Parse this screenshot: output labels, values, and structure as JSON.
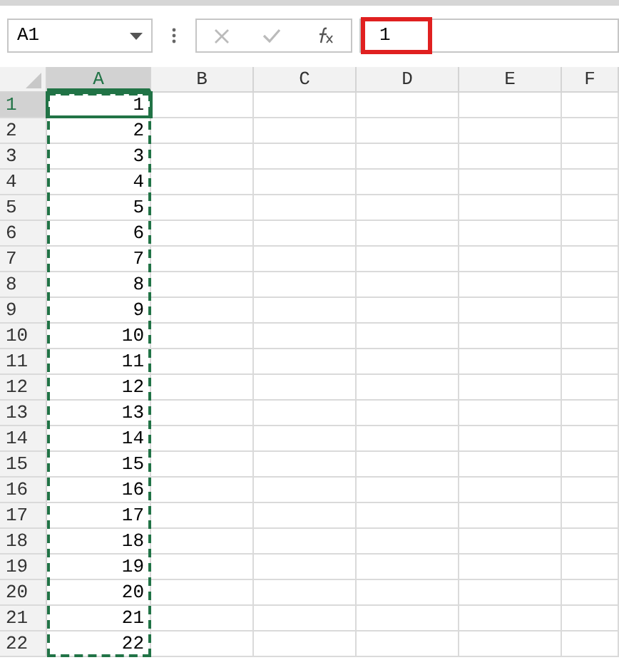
{
  "name_box": {
    "value": "A1"
  },
  "formula_bar": {
    "value": "1",
    "highlighted": true
  },
  "columns": [
    {
      "label": "A",
      "selected": true,
      "copied": true
    },
    {
      "label": "B",
      "selected": false,
      "copied": false
    },
    {
      "label": "C",
      "selected": false,
      "copied": false
    },
    {
      "label": "D",
      "selected": false,
      "copied": false
    },
    {
      "label": "E",
      "selected": false,
      "copied": false
    },
    {
      "label": "F",
      "selected": false,
      "copied": false
    }
  ],
  "rows": [
    {
      "label": "1",
      "selected": true,
      "cells": [
        "1"
      ]
    },
    {
      "label": "2",
      "selected": false,
      "cells": [
        "2"
      ]
    },
    {
      "label": "3",
      "selected": false,
      "cells": [
        "3"
      ]
    },
    {
      "label": "4",
      "selected": false,
      "cells": [
        "4"
      ]
    },
    {
      "label": "5",
      "selected": false,
      "cells": [
        "5"
      ]
    },
    {
      "label": "6",
      "selected": false,
      "cells": [
        "6"
      ]
    },
    {
      "label": "7",
      "selected": false,
      "cells": [
        "7"
      ]
    },
    {
      "label": "8",
      "selected": false,
      "cells": [
        "8"
      ]
    },
    {
      "label": "9",
      "selected": false,
      "cells": [
        "9"
      ]
    },
    {
      "label": "10",
      "selected": false,
      "cells": [
        "10"
      ]
    },
    {
      "label": "11",
      "selected": false,
      "cells": [
        "11"
      ]
    },
    {
      "label": "12",
      "selected": false,
      "cells": [
        "12"
      ]
    },
    {
      "label": "13",
      "selected": false,
      "cells": [
        "13"
      ]
    },
    {
      "label": "14",
      "selected": false,
      "cells": [
        "14"
      ]
    },
    {
      "label": "15",
      "selected": false,
      "cells": [
        "15"
      ]
    },
    {
      "label": "16",
      "selected": false,
      "cells": [
        "16"
      ]
    },
    {
      "label": "17",
      "selected": false,
      "cells": [
        "17"
      ]
    },
    {
      "label": "18",
      "selected": false,
      "cells": [
        "18"
      ]
    },
    {
      "label": "19",
      "selected": false,
      "cells": [
        "19"
      ]
    },
    {
      "label": "20",
      "selected": false,
      "cells": [
        "20"
      ]
    },
    {
      "label": "21",
      "selected": false,
      "cells": [
        "21"
      ]
    },
    {
      "label": "22",
      "selected": false,
      "cells": [
        "22"
      ]
    }
  ]
}
